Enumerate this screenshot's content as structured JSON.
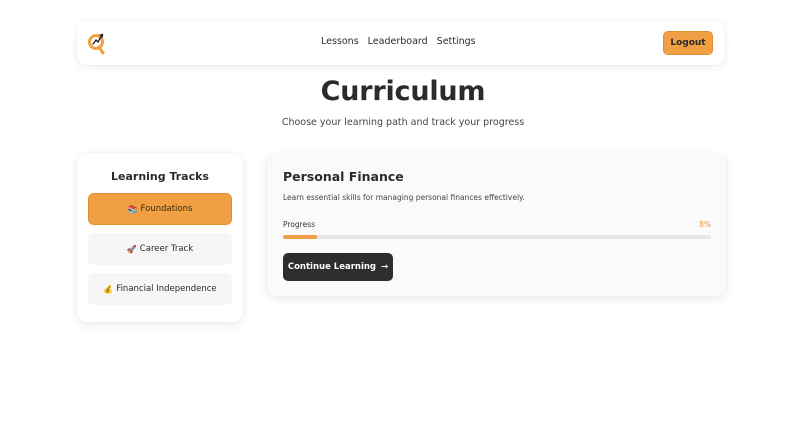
{
  "nav": {
    "links": [
      "Lessons",
      "Leaderboard",
      "Settings"
    ],
    "logout_label": "Logout",
    "accent": "#f0a043"
  },
  "page": {
    "title": "Curriculum",
    "subtitle": "Choose your learning path and track your progress"
  },
  "tracks": {
    "title": "Learning Tracks",
    "items": [
      {
        "icon": "📚",
        "label": "Foundations",
        "active": true
      },
      {
        "icon": "🚀",
        "label": "Career Track",
        "active": false
      },
      {
        "icon": "💰",
        "label": "Financial Independence",
        "active": false
      }
    ]
  },
  "detail": {
    "title": "Personal Finance",
    "description": "Learn essential skills for managing personal finances effectively.",
    "progress_label": "Progress",
    "progress_value": "8%",
    "progress_fraction": 0.08,
    "continue_label": "Continue Learning",
    "continue_icon": "→"
  }
}
